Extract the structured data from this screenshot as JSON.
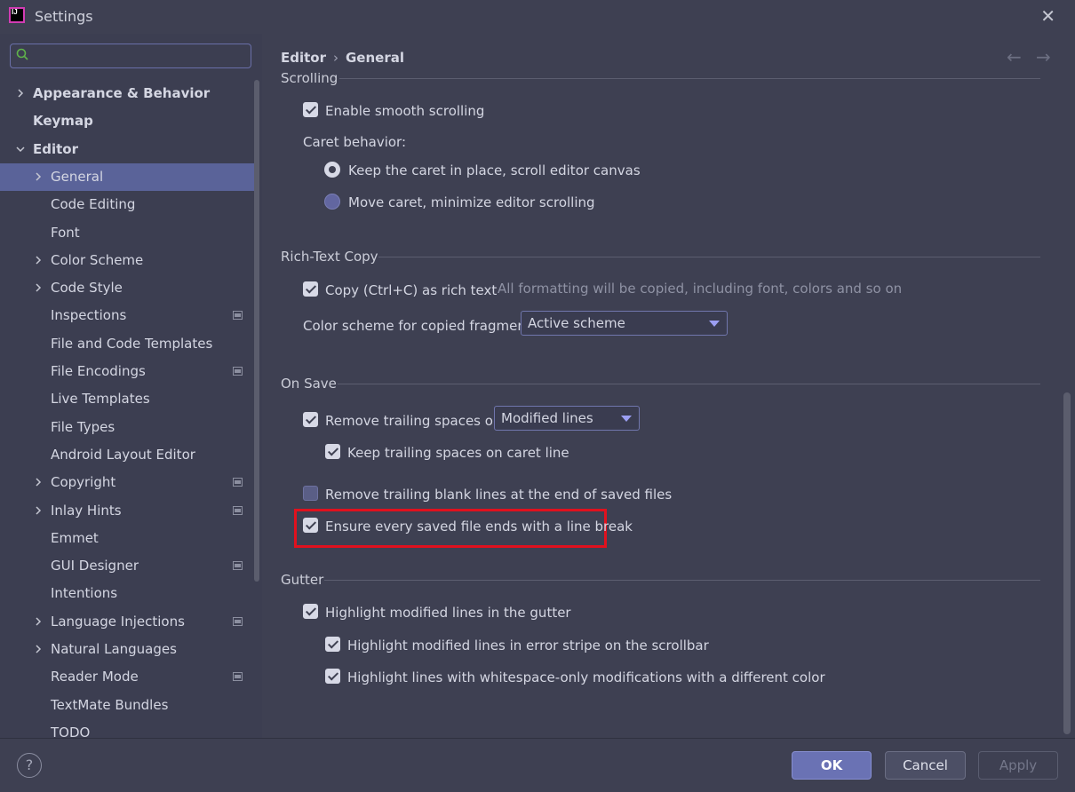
{
  "window": {
    "title": "Settings"
  },
  "search": {
    "placeholder": "",
    "value": ""
  },
  "sidebar": {
    "items": [
      {
        "label": "Appearance & Behavior",
        "expand": "collapsed",
        "bold": true,
        "indent": 0
      },
      {
        "label": "Keymap",
        "expand": "none",
        "bold": true,
        "indent": 0
      },
      {
        "label": "Editor",
        "expand": "expanded",
        "bold": true,
        "indent": 0
      },
      {
        "label": "General",
        "expand": "collapsed",
        "bold": false,
        "indent": 1,
        "selected": true
      },
      {
        "label": "Code Editing",
        "expand": "none",
        "bold": false,
        "indent": 1
      },
      {
        "label": "Font",
        "expand": "none",
        "bold": false,
        "indent": 1
      },
      {
        "label": "Color Scheme",
        "expand": "collapsed",
        "bold": false,
        "indent": 1
      },
      {
        "label": "Code Style",
        "expand": "collapsed",
        "bold": false,
        "indent": 1
      },
      {
        "label": "Inspections",
        "expand": "none",
        "bold": false,
        "indent": 1,
        "project_icon": true
      },
      {
        "label": "File and Code Templates",
        "expand": "none",
        "bold": false,
        "indent": 1
      },
      {
        "label": "File Encodings",
        "expand": "none",
        "bold": false,
        "indent": 1,
        "project_icon": true
      },
      {
        "label": "Live Templates",
        "expand": "none",
        "bold": false,
        "indent": 1
      },
      {
        "label": "File Types",
        "expand": "none",
        "bold": false,
        "indent": 1
      },
      {
        "label": "Android Layout Editor",
        "expand": "none",
        "bold": false,
        "indent": 1
      },
      {
        "label": "Copyright",
        "expand": "collapsed",
        "bold": false,
        "indent": 1,
        "project_icon": true
      },
      {
        "label": "Inlay Hints",
        "expand": "collapsed",
        "bold": false,
        "indent": 1,
        "project_icon": true
      },
      {
        "label": "Emmet",
        "expand": "none",
        "bold": false,
        "indent": 1
      },
      {
        "label": "GUI Designer",
        "expand": "none",
        "bold": false,
        "indent": 1,
        "project_icon": true
      },
      {
        "label": "Intentions",
        "expand": "none",
        "bold": false,
        "indent": 1
      },
      {
        "label": "Language Injections",
        "expand": "collapsed",
        "bold": false,
        "indent": 1,
        "project_icon": true
      },
      {
        "label": "Natural Languages",
        "expand": "collapsed",
        "bold": false,
        "indent": 1
      },
      {
        "label": "Reader Mode",
        "expand": "none",
        "bold": false,
        "indent": 1,
        "project_icon": true
      },
      {
        "label": "TextMate Bundles",
        "expand": "none",
        "bold": false,
        "indent": 1
      },
      {
        "label": "TODO",
        "expand": "none",
        "bold": false,
        "indent": 1
      }
    ]
  },
  "breadcrumb": {
    "parent": "Editor",
    "sep": "›",
    "current": "General"
  },
  "sections": {
    "scrolling": {
      "title": "Scrolling",
      "smooth_scrolling": {
        "label": "Enable smooth scrolling",
        "checked": true
      },
      "caret_behavior_label": "Caret behavior:",
      "caret_keep": {
        "label": "Keep the caret in place, scroll editor canvas",
        "selected": true
      },
      "caret_move": {
        "label": "Move caret, minimize editor scrolling",
        "selected": false
      }
    },
    "rich_text": {
      "title": "Rich-Text Copy",
      "copy_rich": {
        "label": "Copy (Ctrl+C) as rich text",
        "checked": true
      },
      "copy_hint": "All formatting will be copied, including font, colors and so on",
      "scheme_label": "Color scheme for copied fragment:",
      "scheme_value": "Active scheme"
    },
    "on_save": {
      "title": "On Save",
      "remove_trailing": {
        "label": "Remove trailing spaces on:",
        "checked": true
      },
      "trailing_value": "Modified lines",
      "keep_trailing": {
        "label": "Keep trailing spaces on caret line",
        "checked": true
      },
      "remove_blank": {
        "label": "Remove trailing blank lines at the end of saved files",
        "checked": false
      },
      "ensure_break": {
        "label": "Ensure every saved file ends with a line break",
        "checked": true
      }
    },
    "gutter": {
      "title": "Gutter",
      "highlight_gutter": {
        "label": "Highlight modified lines in the gutter",
        "checked": true
      },
      "highlight_stripe": {
        "label": "Highlight modified lines in error stripe on the scrollbar",
        "checked": true
      },
      "highlight_whitespace": {
        "label": "Highlight lines with whitespace-only modifications with a different color",
        "checked": true
      }
    }
  },
  "buttons": {
    "ok": "OK",
    "cancel": "Cancel",
    "apply": "Apply",
    "help": "?"
  },
  "colors": {
    "background": "#3e4052",
    "selection": "#5a6399",
    "highlight_box": "#e0111e",
    "accent": "#6a72b4"
  }
}
